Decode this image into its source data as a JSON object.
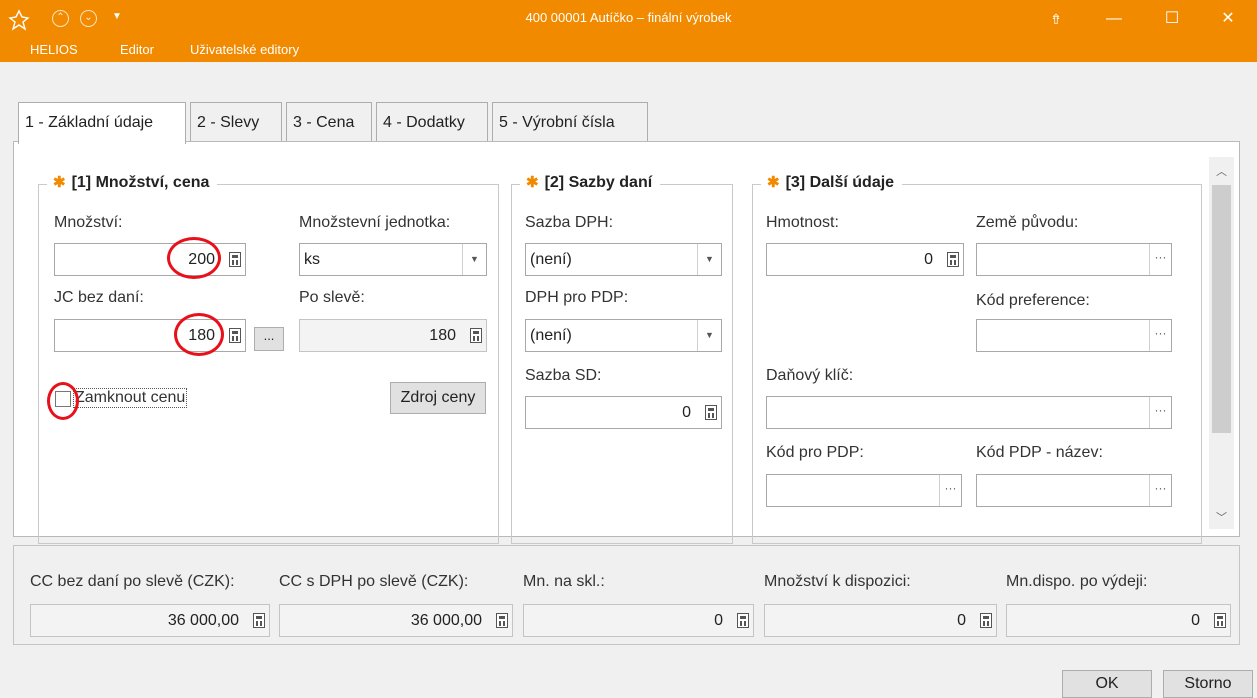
{
  "window": {
    "title": "400 00001 Autíčko – finální výrobek",
    "menu": [
      "HELIOS",
      "Editor",
      "Uživatelské editory"
    ],
    "controls": {
      "restore_up": "⇮",
      "minimize": "—",
      "maximize": "☐",
      "close": "✕"
    }
  },
  "tabs": [
    "1 - Základní údaje",
    "2 - Slevy",
    "3 - Cena",
    "4 - Dodatky",
    "5 - Výrobní čísla"
  ],
  "group1": {
    "title": "[1] Množství, cena",
    "mnozstvi_label": "Množství:",
    "mnozstvi_value": "200",
    "jednotka_label": "Množstevní jednotka:",
    "jednotka_value": "ks",
    "jc_label": "JC bez daní:",
    "jc_value": "180",
    "po_sleve_label": "Po slevě:",
    "po_sleve_value": "180",
    "ellipsis": "...",
    "zamknout_label": "Zamknout cenu",
    "zdroj_button": "Zdroj ceny"
  },
  "group2": {
    "title": "[2] Sazby daní",
    "sazba_dph_label": "Sazba DPH:",
    "sazba_dph_value": "(není)",
    "dph_pdp_label": "DPH pro PDP:",
    "dph_pdp_value": "(není)",
    "sazba_sd_label": "Sazba SD:",
    "sazba_sd_value": "0"
  },
  "group3": {
    "title": "[3] Další údaje",
    "hmotnost_label": "Hmotnost:",
    "hmotnost_value": "0",
    "zeme_label": "Země původu:",
    "kod_pref_label": "Kód preference:",
    "danovy_label": "Daňový klíč:",
    "kod_pdp_label": "Kód pro PDP:",
    "kod_pdp_nazev_label": "Kód PDP - název:",
    "ellipsis": "···"
  },
  "summary": [
    {
      "label": "CC bez daní po slevě (CZK):",
      "value": "36 000,00"
    },
    {
      "label": "CC s DPH po slevě (CZK):",
      "value": "36 000,00"
    },
    {
      "label": "Mn. na skl.:",
      "value": "0"
    },
    {
      "label": "Množství k dispozici:",
      "value": "0"
    },
    {
      "label": "Mn.dispo. po výdeji:",
      "value": "0"
    }
  ],
  "buttons": {
    "ok": "OK",
    "cancel": "Storno"
  },
  "colors": {
    "accent": "#f28a00",
    "annotation": "#e8101a"
  }
}
